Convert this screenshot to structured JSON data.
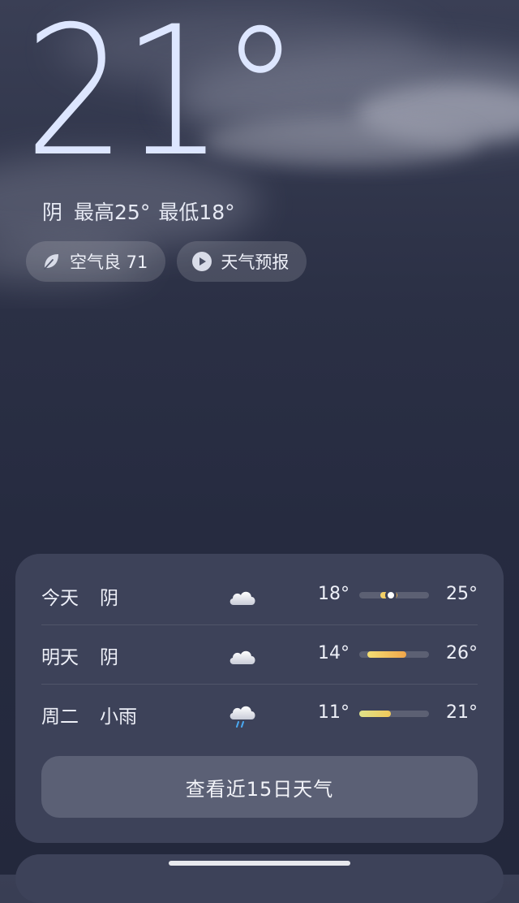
{
  "current": {
    "temperature": "21°",
    "condition": "阴",
    "high": "最高25°",
    "low": "最低18°"
  },
  "chips": {
    "air_quality": "空气良 71",
    "forecast_video": "天气预报"
  },
  "forecast": [
    {
      "day": "今天",
      "condition": "阴",
      "icon": "cloudy-icon",
      "low": "18°",
      "high": "25°",
      "range": [
        0.3,
        0.55
      ],
      "current_marker": 0.45,
      "colors": [
        "#f3d46a",
        "#f0b34a"
      ]
    },
    {
      "day": "明天",
      "condition": "阴",
      "icon": "cloudy-icon",
      "low": "14°",
      "high": "26°",
      "range": [
        0.12,
        0.68
      ],
      "colors": [
        "#f4df74",
        "#f1a64a"
      ]
    },
    {
      "day": "周二",
      "condition": "小雨",
      "icon": "light-rain-icon",
      "low": "11°",
      "high": "21°",
      "range": [
        0.0,
        0.45
      ],
      "colors": [
        "#dfe28a",
        "#f0c95a"
      ]
    }
  ],
  "more_button": "查看近15日天气"
}
